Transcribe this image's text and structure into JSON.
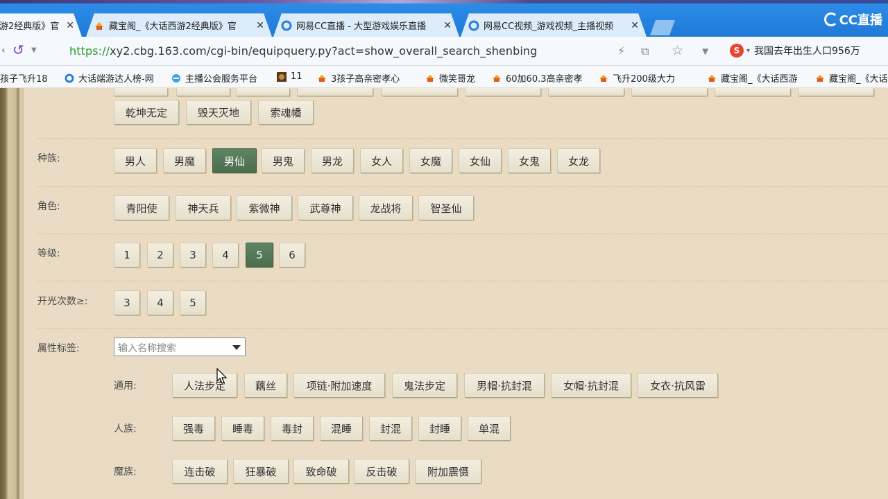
{
  "browser": {
    "tabs": [
      {
        "label": "游2经典版》官",
        "icon": "page-icon",
        "active": true
      },
      {
        "label": "藏宝阁_《大话西游2经典版》官",
        "icon": "treasure-icon",
        "active": false
      },
      {
        "label": "网易CC直播 - 大型游戏娱乐直播",
        "icon": "cc-icon",
        "active": false
      },
      {
        "label": "网易CC视频_游戏视频_主播视频",
        "icon": "cc-icon",
        "active": false
      }
    ],
    "brand": "CC直播",
    "url_scheme": "https://",
    "url_rest": "xy2.cbg.163.com/cgi-bin/equipquery.py?act=show_overall_search_shenbing",
    "search_hint": "我国去年出生人口956万",
    "bookmarks": [
      {
        "label": "孩子飞升18",
        "icon": "none"
      },
      {
        "label": "大话端游达人榜-网",
        "icon": "cc-icon"
      },
      {
        "label": "主播公会服务平台",
        "icon": "ie-icon"
      },
      {
        "label": "11",
        "icon": "game-icon"
      },
      {
        "label": "3孩子高亲密孝心",
        "icon": "treasure-icon"
      },
      {
        "label": "微笑哥龙",
        "icon": "treasure-icon"
      },
      {
        "label": "60加60.3高亲密孝",
        "icon": "treasure-icon"
      },
      {
        "label": "飞升200级大力",
        "icon": "treasure-icon"
      },
      {
        "label": "藏宝阁_《大话西游",
        "icon": "treasure-icon"
      },
      {
        "label": "藏宝阁_《大话",
        "icon": "treasure-icon"
      }
    ]
  },
  "filters": {
    "weapon_row": [
      "乾坤无定",
      "毁天灭地",
      "索魂幡"
    ],
    "race": {
      "label": "种族:",
      "options": [
        "男人",
        "男魔",
        "男仙",
        "男鬼",
        "男龙",
        "女人",
        "女魔",
        "女仙",
        "女鬼",
        "女龙"
      ],
      "selected": "男仙"
    },
    "role": {
      "label": "角色:",
      "options": [
        "青阳使",
        "神天兵",
        "紫微神",
        "武尊神",
        "龙战将",
        "智圣仙"
      ]
    },
    "level": {
      "label": "等级:",
      "options": [
        "1",
        "2",
        "3",
        "4",
        "5",
        "6"
      ],
      "selected": "5"
    },
    "light": {
      "label": "开光次数≥:",
      "options": [
        "3",
        "4",
        "5"
      ]
    },
    "attr": {
      "label": "属性标签:",
      "placeholder": "输入名称搜索",
      "groups": [
        {
          "label": "通用:",
          "options": [
            "人法步定",
            "藕丝",
            "项链·附加速度",
            "鬼法步定",
            "男帽·抗封混",
            "女帽·抗封混",
            "女衣·抗风雷"
          ]
        },
        {
          "label": "人族:",
          "options": [
            "强毒",
            "睡毒",
            "毒封",
            "混睡",
            "封混",
            "封睡",
            "单混"
          ]
        },
        {
          "label": "魔族:",
          "options": [
            "连击破",
            "狂暴破",
            "致命破",
            "反击破",
            "附加震慑"
          ]
        }
      ]
    }
  }
}
